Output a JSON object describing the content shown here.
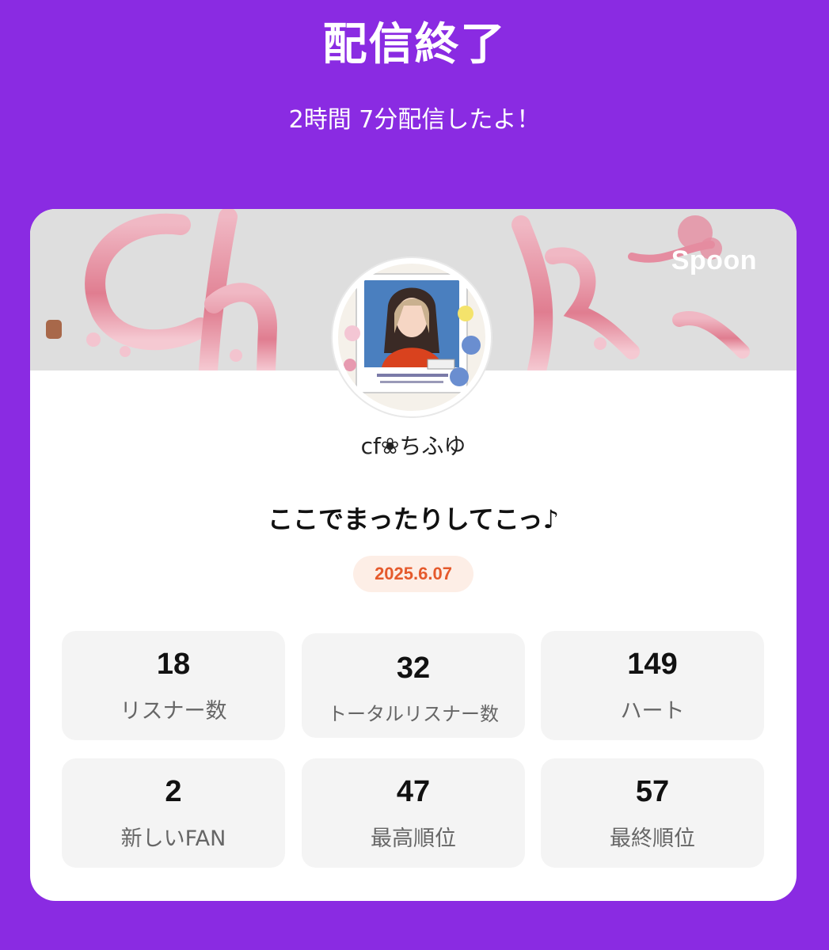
{
  "header": {
    "title": "配信終了",
    "subtitle": "2時間 7分配信したよ！"
  },
  "card": {
    "brand": "Spoon",
    "username": "cf❀ちふゆ",
    "stream_title": "ここでまったりしてこっ♪",
    "date": "2025.6.07"
  },
  "stats": [
    {
      "value": "18",
      "label": "リスナー数"
    },
    {
      "value": "32",
      "label": "トータルリスナー数"
    },
    {
      "value": "149",
      "label": "ハート"
    },
    {
      "value": "2",
      "label": "新しいFAN"
    },
    {
      "value": "47",
      "label": "最高順位"
    },
    {
      "value": "57",
      "label": "最終順位"
    }
  ],
  "colors": {
    "background": "#8a2be2",
    "card": "#ffffff",
    "date_badge_bg": "#fdeee6",
    "date_badge_text": "#e55a2c",
    "stat_bg": "#f4f4f4"
  }
}
